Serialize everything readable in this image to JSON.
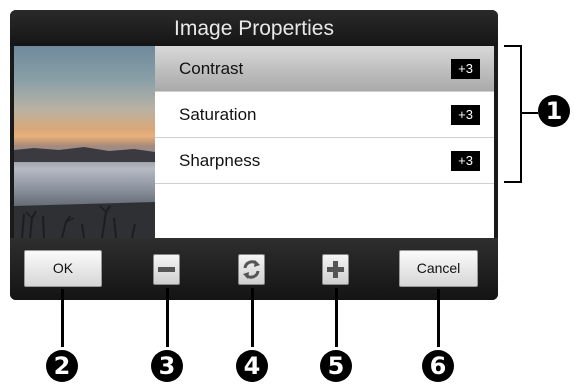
{
  "dialog": {
    "title": "Image Properties"
  },
  "properties": [
    {
      "label": "Contrast",
      "value": "+3",
      "selected": true
    },
    {
      "label": "Saturation",
      "value": "+3",
      "selected": false
    },
    {
      "label": "Sharpness",
      "value": "+3",
      "selected": false
    }
  ],
  "toolbar": {
    "ok_label": "OK",
    "decrease_icon": "minus-icon",
    "reset_icon": "refresh-icon",
    "increase_icon": "plus-icon",
    "cancel_label": "Cancel"
  },
  "callouts": {
    "list": "1",
    "ok": "2",
    "decrease": "3",
    "reset": "4",
    "increase": "5",
    "cancel": "6"
  },
  "colors": {
    "frame": "#1a1a1a",
    "selected_row": "#bdbdbd",
    "value_badge": "#000000"
  }
}
